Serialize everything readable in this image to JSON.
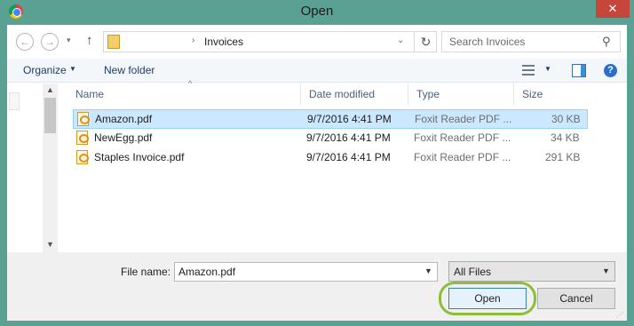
{
  "window": {
    "title": "Open",
    "close_glyph": "✕"
  },
  "nav": {
    "back_glyph": "←",
    "forward_glyph": "→",
    "recent_glyph": "▾",
    "up_glyph": "↑",
    "crumb_separator": "›",
    "crumb": "Invoices",
    "address_drop_glyph": "⌄",
    "refresh_glyph": "↻",
    "search_placeholder": "Search Invoices",
    "search_glyph": "⚲"
  },
  "toolbar": {
    "organize_label": "Organize",
    "organize_caret": "▼",
    "new_folder_label": "New folder",
    "view_caret": "▼",
    "help_glyph": "?"
  },
  "list": {
    "columns": {
      "name": "Name",
      "date": "Date modified",
      "type": "Type",
      "size": "Size"
    },
    "sort_glyph": "^",
    "rows": [
      {
        "name": "Amazon.pdf",
        "date": "9/7/2016 4:41 PM",
        "type": "Foxit Reader PDF ...",
        "size": "30 KB",
        "selected": true
      },
      {
        "name": "NewEgg.pdf",
        "date": "9/7/2016 4:41 PM",
        "type": "Foxit Reader PDF ...",
        "size": "34 KB",
        "selected": false
      },
      {
        "name": "Staples Invoice.pdf",
        "date": "9/7/2016 4:41 PM",
        "type": "Foxit Reader PDF ...",
        "size": "291 KB",
        "selected": false
      }
    ]
  },
  "scroll": {
    "up_glyph": "▲",
    "down_glyph": "▼"
  },
  "bottom": {
    "file_name_label": "File name:",
    "file_name_value": "Amazon.pdf",
    "file_name_drop": "▼",
    "filter_value": "All Files",
    "filter_drop": "▼",
    "open_label": "Open",
    "cancel_label": "Cancel",
    "grip_glyph": "⋰"
  }
}
